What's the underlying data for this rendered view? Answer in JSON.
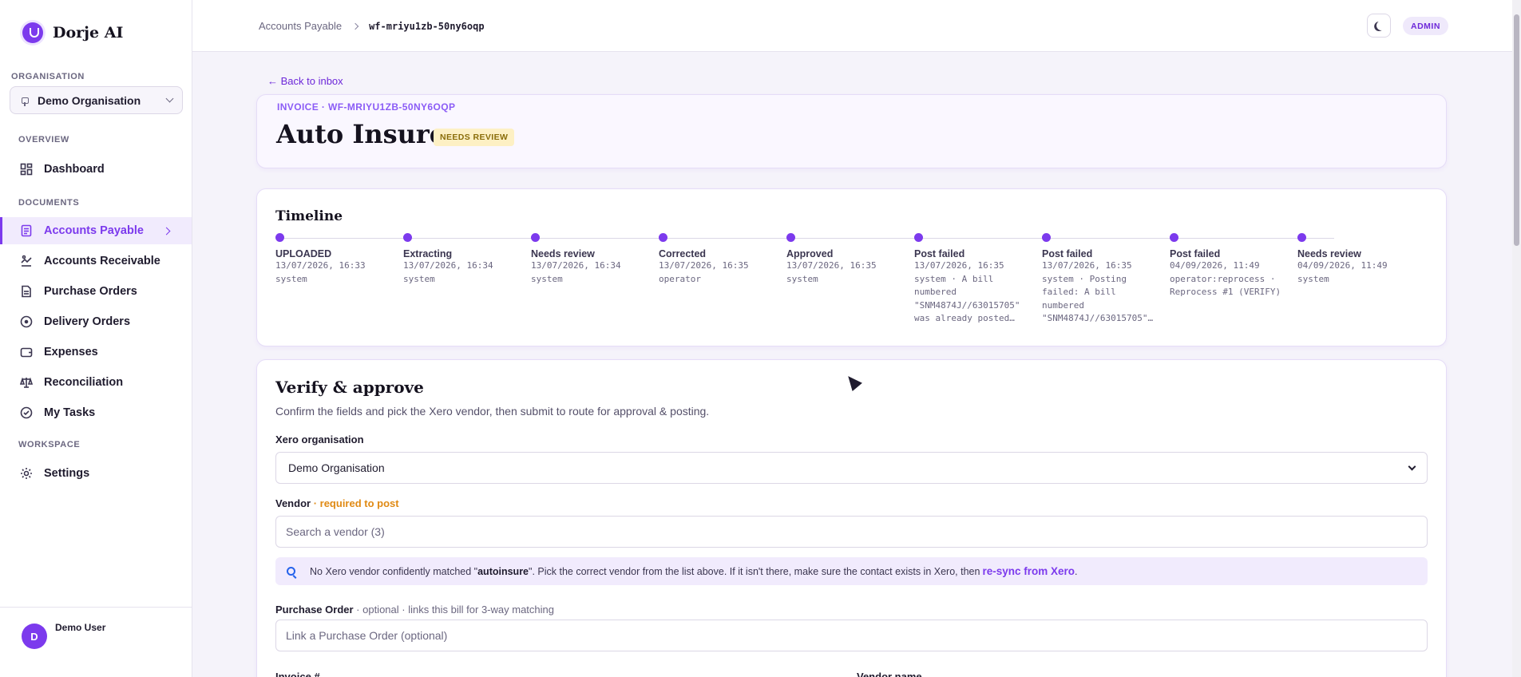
{
  "app": {
    "name": "Dorje AI"
  },
  "sidebar": {
    "org_section_label": "ORGANISATION",
    "org_value": "Demo Organisation",
    "overview_label": "OVERVIEW",
    "documents_label": "DOCUMENTS",
    "workspace_label": "WORKSPACE",
    "items": [
      {
        "label": "Dashboard",
        "icon": "dashboard-icon"
      },
      {
        "label": "Accounts Payable",
        "icon": "document-icon",
        "active": true
      },
      {
        "label": "Accounts Receivable",
        "icon": "receivable-icon"
      },
      {
        "label": "Purchase Orders",
        "icon": "document-icon"
      },
      {
        "label": "Delivery Orders",
        "icon": "clock-icon"
      },
      {
        "label": "Expenses",
        "icon": "wallet-icon"
      },
      {
        "label": "Reconciliation",
        "icon": "scale-icon"
      },
      {
        "label": "My Tasks",
        "icon": "check-circle-icon"
      },
      {
        "label": "Settings",
        "icon": "gear-icon"
      }
    ],
    "user": {
      "initial": "D",
      "name": "Demo User"
    }
  },
  "header": {
    "breadcrumb_parent": "Accounts Payable",
    "breadcrumb_current": "wf-mriyu1zb-50ny6oqp",
    "role_badge": "ADMIN"
  },
  "page": {
    "back_link": "← Back to inbox",
    "invoice_tag": "INVOICE · WF-MRIYU1ZB-50NY6OQP",
    "title": "Auto Insure",
    "status": "NEEDS REVIEW"
  },
  "timeline": {
    "title": "Timeline",
    "steps": [
      {
        "label": "UPLOADED",
        "time": "13/07/2026, 16:33",
        "actor": "system"
      },
      {
        "label": "Extracting",
        "time": "13/07/2026, 16:34",
        "actor": "system"
      },
      {
        "label": "Needs review",
        "time": "13/07/2026, 16:34",
        "actor": "system"
      },
      {
        "label": "Corrected",
        "time": "13/07/2026, 16:35",
        "actor": "operator"
      },
      {
        "label": "Approved",
        "time": "13/07/2026, 16:35",
        "actor": "system"
      },
      {
        "label": "Post failed",
        "time": "13/07/2026, 16:35",
        "actor": "system · A bill numbered \"SNM4874J//63015705\" was already posted…"
      },
      {
        "label": "Post failed",
        "time": "13/07/2026, 16:35",
        "actor": "system · Posting failed: A bill numbered \"SNM4874J//63015705\"…"
      },
      {
        "label": "Post failed",
        "time": "04/09/2026, 11:49",
        "actor": "operator:reprocess · Reprocess #1 (VERIFY)"
      },
      {
        "label": "Needs review",
        "time": "04/09/2026, 11:49",
        "actor": "system"
      }
    ]
  },
  "verify": {
    "title": "Verify & approve",
    "subtitle": "Confirm the fields and pick the Xero vendor, then submit to route for approval & posting.",
    "xero_org_label": "Xero organisation",
    "xero_org_value": "Demo Organisation",
    "vendor_label": "Vendor",
    "vendor_required": "· required to post",
    "vendor_placeholder": "Search a vendor (3)",
    "notice_prefix": "No Xero vendor confidently matched \"",
    "notice_match": "autoinsure",
    "notice_suffix": "\". Pick the correct vendor from the list above. If it isn't there, make sure the contact exists in Xero, then",
    "notice_link": "re-sync from Xero",
    "notice_end": ".",
    "po_label": "Purchase Order",
    "po_hint": "· optional · links this bill for 3-way matching",
    "po_placeholder": "Link a Purchase Order (optional)",
    "invoice_no_label": "Invoice #",
    "vendor_name_label": "Vendor name"
  }
}
